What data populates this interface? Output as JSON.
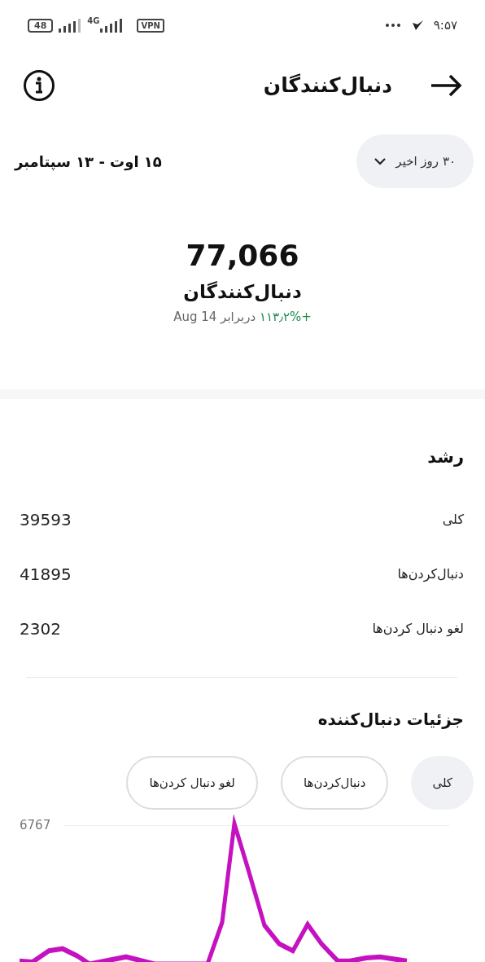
{
  "status_bar": {
    "time": "۹:۵۷",
    "battery": "48",
    "network": "4G",
    "vpn": "VPN"
  },
  "header": {
    "title": "دنبال‌کنندگان"
  },
  "date_range": "۱۵ اوت - ۱۳ سپتامبر",
  "period_button": "۳۰ روز اخیر",
  "summary": {
    "value": "77,066",
    "label": "دنبال‌کنندگان",
    "change": "+۱۱۳٫۲%",
    "comparison": "دربرابر Aug 14"
  },
  "growth": {
    "title": "رشد",
    "rows": [
      {
        "label": "کلی",
        "value": "39593"
      },
      {
        "label": "دنبال‌کردن‌ها",
        "value": "41895"
      },
      {
        "label": "لغو دنبال کردن‌ها",
        "value": "2302"
      }
    ]
  },
  "details": {
    "title": "جزئیات دنبال‌کننده",
    "filters": [
      {
        "label": "کلی",
        "selected": true
      },
      {
        "label": "دنبال‌کردن‌ها",
        "selected": false
      },
      {
        "label": "لغو دنبال کردن‌ها",
        "selected": false
      }
    ]
  },
  "chart": {
    "y_label": "6767"
  }
}
